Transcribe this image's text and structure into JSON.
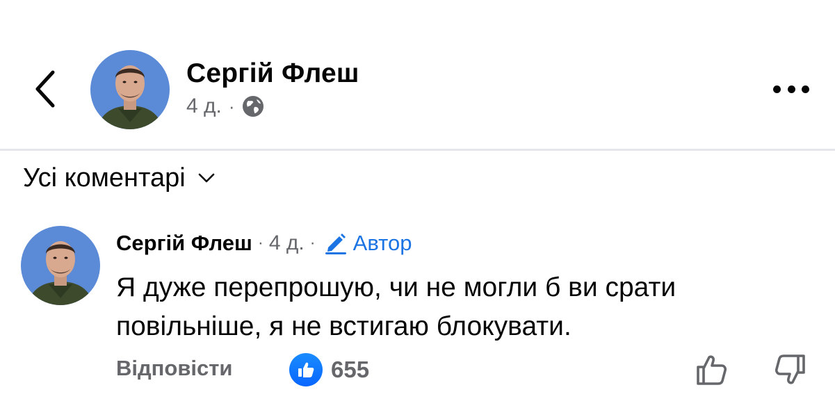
{
  "post_header": {
    "author_name": "Сергій Флеш",
    "time": "4 д.",
    "separator": "·",
    "privacy_icon": "globe-icon",
    "back_icon": "chevron-left-icon",
    "more_icon": "more-horizontal-icon"
  },
  "comments_filter": {
    "label": "Усі коментарі",
    "icon": "chevron-down-icon"
  },
  "comment": {
    "author_name": "Сергій Флеш",
    "separator": "·",
    "time": "4 д.",
    "badge_icon": "pencil-icon",
    "badge_label": "Автор",
    "text": "Я дуже перепрошую, чи не могли б ви срати повільніше, я не встигаю блокувати.",
    "reply_label": "Відповісти",
    "like_icon": "thumbs-up-icon",
    "like_count": "655",
    "upvote_icon": "upvote-icon",
    "downvote_icon": "downvote-icon"
  },
  "colors": {
    "text_primary": "#050505",
    "text_secondary": "#65676b",
    "accent_blue": "#1b74e4",
    "like_blue": "#0866ff",
    "avatar_background": "#5b8ad6",
    "divider": "#e4e6eb"
  }
}
